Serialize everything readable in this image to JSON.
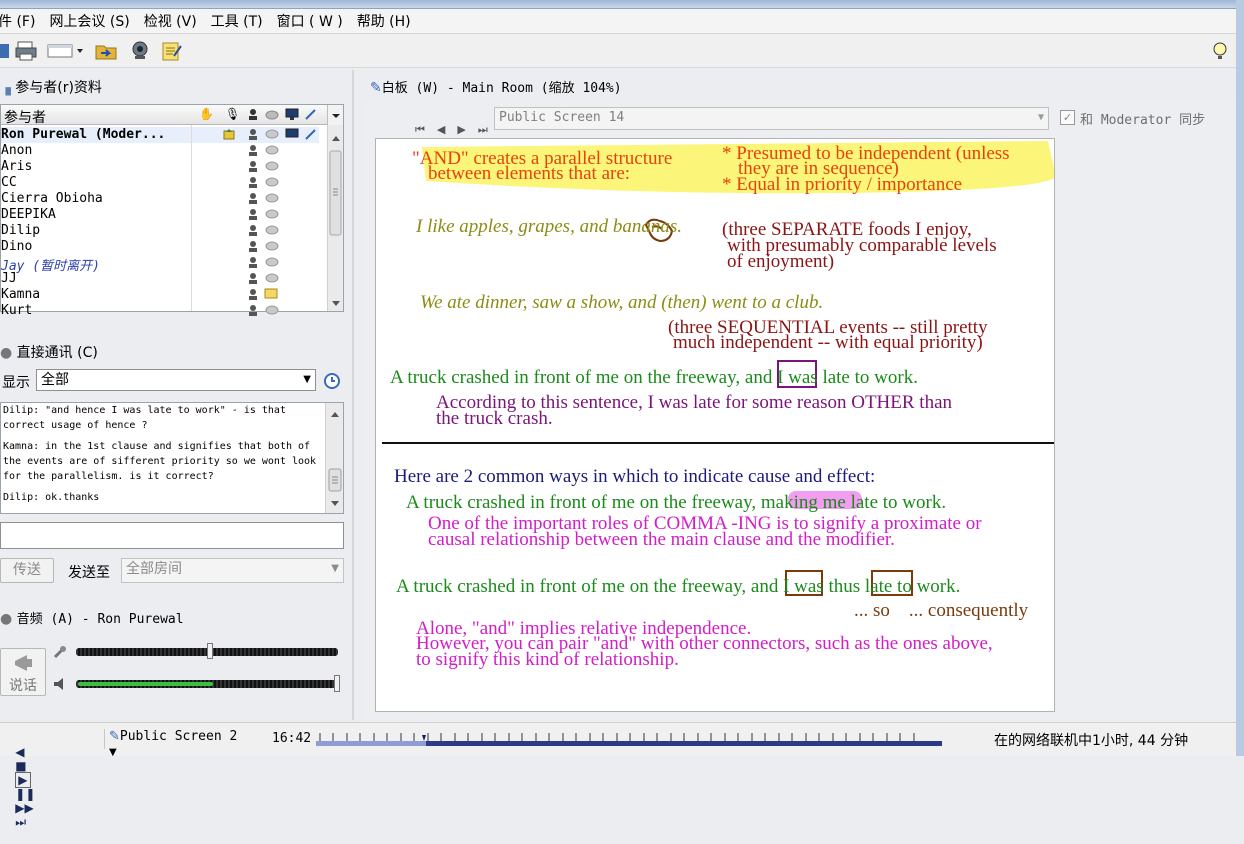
{
  "menu": [
    "件 (F)",
    "网上会议 (S)",
    "检视 (V)",
    "工具 (T)",
    "窗口 ( W )",
    "帮助 (H)"
  ],
  "participants": {
    "title": "参与者(r)资料",
    "header_label": "参与者",
    "rows": [
      {
        "name": "Ron Purewal (Moder...",
        "bold": true
      },
      {
        "name": "Anon"
      },
      {
        "name": "Aris"
      },
      {
        "name": "CC"
      },
      {
        "name": "Cierra Obioha"
      },
      {
        "name": "DEEPIKA"
      },
      {
        "name": "Dilip"
      },
      {
        "name": "Dino"
      },
      {
        "name": "Jay (暂时离开)",
        "away": true
      },
      {
        "name": "JJ"
      },
      {
        "name": "Kamna"
      },
      {
        "name": "Kurt"
      }
    ]
  },
  "chat": {
    "title": "直接通讯 (C)",
    "show_label": "显示",
    "show_value": "全部",
    "messages": [
      "Dilip: \"and hence I was late to work\" - is that\ncorrect usage of hence ?",
      "Kamna: in the 1st clause and signifies that both of\nthe events are of sifferent priority so we wont look\nfor the parallelism. is it correct?",
      "Dilip: ok.thanks"
    ],
    "send_button": "传送",
    "send_to_label": "发送至",
    "send_to_value": "全部房间",
    "input_value": ""
  },
  "audio": {
    "title": "音频 (A) - Ron Purewal",
    "talk_label": "说话",
    "mic_level": 0.54,
    "speaker_level": 0.5
  },
  "whiteboard": {
    "title": "白板 (W) - Main Room (缩放 104%)",
    "screen_select": "Public Screen 14",
    "sync_label": "和 Moderator 同步",
    "sync_checked": true,
    "lines": {
      "a1": "\"AND\" creates a parallel structure",
      "a2": "between elements that are:",
      "a3": "* Presumed to be independent (unless",
      "a4": "they are in sequence)",
      "a5": "* Equal in priority / importance",
      "b1": "I like apples, grapes, and bananas.",
      "b2": "(three SEPARATE foods I enjoy,",
      "b3": "with presumably comparable levels",
      "b4": "of enjoyment)",
      "c1": "We ate dinner, saw a show, and (then) went to a club.",
      "c2": "(three SEQUENTIAL events -- still pretty",
      "c3": "much independent -- with equal priority)",
      "d1": "A truck crashed in front of me on the freeway, and I was late to work.",
      "d2": "According to this sentence, I was late for some reason OTHER than",
      "d3": "the truck crash.",
      "e1": "Here are 2 common ways in which to indicate cause and effect:",
      "e2": "A truck crashed in front of me on the freeway, making me late to work.",
      "e3": "One of the important roles of COMMA -ING is to signify a proximate or",
      "e4": "causal relationship between the main clause and the modifier.",
      "f1": "A truck crashed in front of me on the freeway, and I was thus late to work.",
      "f2": "... so    ... consequently",
      "g1": "Alone, \"and\" implies relative independence.",
      "g2": "However, you can pair \"and\" with other connectors, such as the ones above,",
      "g3": "to signify this kind of relationship."
    }
  },
  "statusbar": {
    "screen": "Public Screen 2",
    "time": "16:42",
    "connection": "在的网络联机中1小时, 44 分钟"
  },
  "colors": {
    "highlight_yellow": "#fbf67a",
    "orange_red": "#e8420c",
    "olive": "#8c8c14",
    "maroon": "#8a1414",
    "green": "#1a8a1a",
    "purple": "#7a147a",
    "navy": "#1a1a7a",
    "magenta": "#d41cc8",
    "brown": "#7a3a0a"
  }
}
